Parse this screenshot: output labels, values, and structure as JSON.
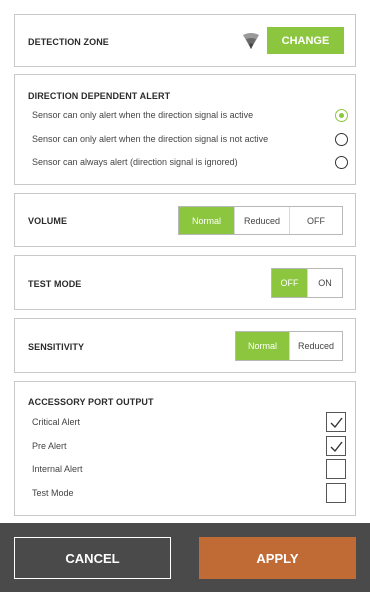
{
  "detection_zone": {
    "title": "DETECTION ZONE",
    "icon": "detection-zone-icon",
    "change_label": "CHANGE"
  },
  "direction_alert": {
    "title": "DIRECTION DEPENDENT ALERT",
    "options": [
      {
        "label": "Sensor can only alert when the direction signal is active",
        "selected": true
      },
      {
        "label": "Sensor can only alert when the direction signal is not active",
        "selected": false
      },
      {
        "label": "Sensor can always alert (direction signal is ignored)",
        "selected": false
      }
    ]
  },
  "volume": {
    "title": "VOLUME",
    "options": [
      "Normal",
      "Reduced",
      "OFF"
    ],
    "selected": "Normal"
  },
  "test_mode": {
    "title": "TEST MODE",
    "options": [
      "OFF",
      "ON"
    ],
    "selected": "OFF"
  },
  "sensitivity": {
    "title": "SENSITIVITY",
    "options": [
      "Normal",
      "Reduced"
    ],
    "selected": "Normal"
  },
  "accessory_port": {
    "title": "ACCESSORY PORT OUTPUT",
    "items": [
      {
        "label": "Critical Alert",
        "checked": true
      },
      {
        "label": "Pre Alert",
        "checked": true
      },
      {
        "label": "Internal Alert",
        "checked": false
      },
      {
        "label": "Test Mode",
        "checked": false
      }
    ]
  },
  "footer": {
    "cancel_label": "CANCEL",
    "apply_label": "APPLY"
  },
  "colors": {
    "accent_green": "#8cc63f",
    "apply_orange": "#c06a35",
    "footer_bg": "#4a4a4a"
  }
}
